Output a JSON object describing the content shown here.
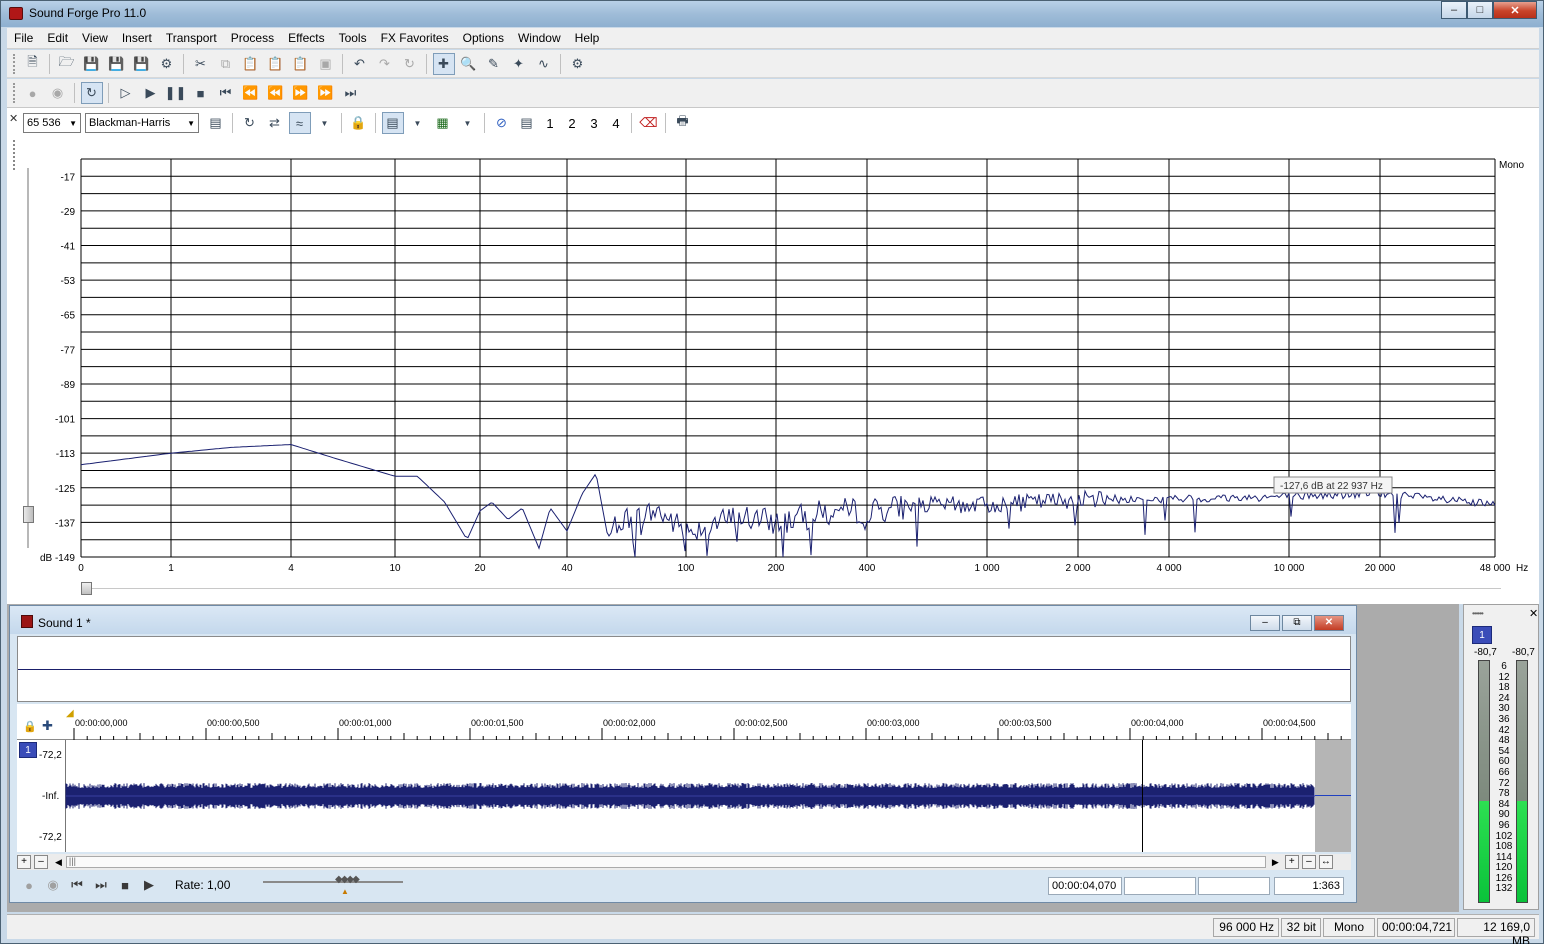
{
  "app": {
    "title": "Sound Forge Pro 11.0"
  },
  "menu": [
    "File",
    "Edit",
    "View",
    "Insert",
    "Transport",
    "Process",
    "Effects",
    "Tools",
    "FX Favorites",
    "Options",
    "Window",
    "Help"
  ],
  "spectrum": {
    "fft_size": "65 536",
    "window_type": "Blackman-Harris",
    "view_buttons": [
      "1",
      "2",
      "3",
      "4"
    ],
    "channel_label": "Mono",
    "tooltip": "-127,6 dB at 22 937 Hz",
    "x_unit": "Hz"
  },
  "chart_data": {
    "type": "line",
    "title": "",
    "xlabel": "Hz",
    "ylabel": "dB",
    "xscale": "log",
    "y_ticks": [
      "-17",
      "-29",
      "-41",
      "-53",
      "-65",
      "-77",
      "-89",
      "-101",
      "-113",
      "-125",
      "-137",
      "dB -149"
    ],
    "x_ticks": [
      "0",
      "1",
      "4",
      "10",
      "20",
      "40",
      "100",
      "200",
      "400",
      "1 000",
      "2 000",
      "4 000",
      "10 000",
      "20 000",
      "48 000"
    ],
    "ylim": [
      -149,
      -11
    ],
    "xlim": [
      0,
      48000
    ],
    "grid": true,
    "series": [
      {
        "values_hz": [
          0,
          1,
          2,
          4,
          6,
          10,
          12,
          15,
          18,
          20,
          22,
          25,
          28,
          32,
          35,
          40,
          45,
          50,
          55,
          60,
          70,
          80,
          100,
          150,
          200,
          300,
          400,
          600,
          1000,
          2000,
          4000,
          10000,
          20000,
          48000
        ],
        "values_db": [
          -117,
          -113,
          -111,
          -110,
          -115,
          -121,
          -121,
          -130,
          -143,
          -133,
          -130,
          -136,
          -132,
          -146,
          -132,
          -140,
          -127,
          -120,
          -143,
          -135,
          -135,
          -133,
          -140,
          -135,
          -137,
          -133,
          -133,
          -131,
          -131,
          -129,
          -129,
          -128,
          -127,
          -131
        ]
      }
    ]
  },
  "document": {
    "title": "Sound 1 *",
    "channel": "1",
    "ruler_labels": [
      "00:00:00,000",
      "00:00:00,500",
      "00:00:01,000",
      "00:00:01,500",
      "00:00:02,000",
      "00:00:02,500",
      "00:00:03,000",
      "00:00:03,500",
      "00:00:04,000",
      "00:00:04,500"
    ],
    "db_labels": [
      "-72,2",
      "-Inf.",
      "-72,2"
    ],
    "rate": "Rate: 1,00",
    "cursor_position": "00:00:04,070",
    "zoom_ratio": "1:363"
  },
  "meter": {
    "channel": "1",
    "peak_left": "-80,7",
    "peak_right": "-80,7",
    "scale": [
      "6",
      "12",
      "18",
      "24",
      "30",
      "36",
      "42",
      "48",
      "54",
      "60",
      "66",
      "72",
      "78",
      "84",
      "90",
      "96",
      "102",
      "108",
      "114",
      "120",
      "126",
      "132"
    ],
    "level_fraction": 0.42
  },
  "status": {
    "sample_rate": "96 000 Hz",
    "bit_depth": "32 bit",
    "channels": "Mono",
    "length": "00:00:04,721",
    "free_space": "12 169,0 MB"
  }
}
